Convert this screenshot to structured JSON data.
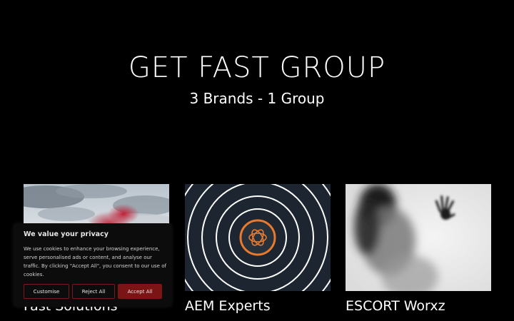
{
  "hero": {
    "title": "GET FAST GROUP",
    "subtitle": "3 Brands - 1 Group"
  },
  "cards": [
    {
      "label": "Fast Solutions",
      "image": "sky-red-smoke-image"
    },
    {
      "label": "AEM Experts",
      "image": "concentric-rings-logo-image"
    },
    {
      "label": "ESCORT Worxz",
      "image": "silhouette-behind-glass-image"
    }
  ],
  "cookie_banner": {
    "title": "We value your privacy",
    "message": "We use cookies to enhance your browsing experience, serve personalised ads or content, and analyse our traffic. By clicking \"Accept All\", you consent to our use of cookies.",
    "customise_label": "Customise",
    "reject_label": "Reject All",
    "accept_label": "Accept All",
    "accent_color": "#7b1515"
  },
  "colors": {
    "background": "#000000",
    "text": "#ffffff"
  }
}
